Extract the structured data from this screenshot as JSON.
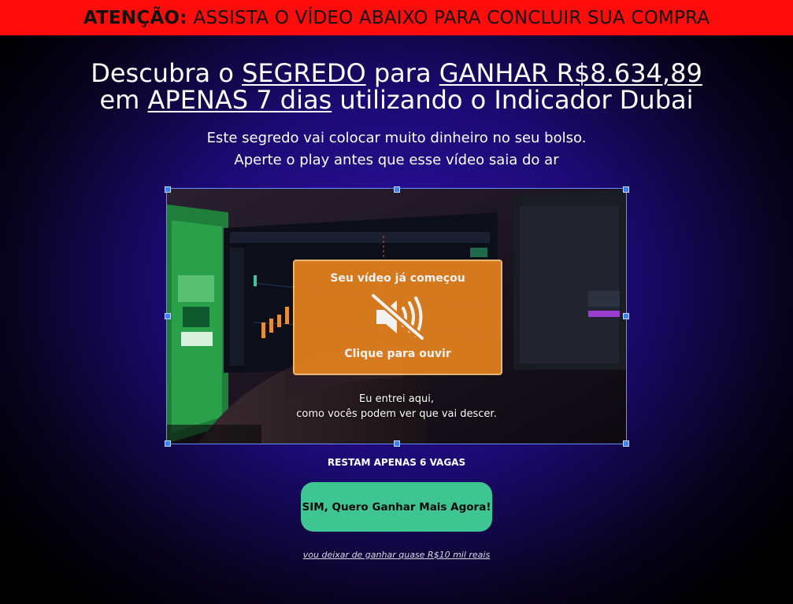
{
  "banner": {
    "strong": "ATENÇÃO:",
    "rest": "ASSISTA O VÍDEO ABAIXO PARA CONCLUIR SUA COMPRA"
  },
  "headline": {
    "w1": "Descubra o",
    "w2": "SEGREDO",
    "w3": "para",
    "w4": "GANHAR R$8.634,89",
    "w5": "em",
    "w6": "APENAS 7 dias",
    "w7": "utilizando o Indicador Dubai"
  },
  "subtext": {
    "line1": "Este segredo vai colocar muito dinheiro no seu bolso.",
    "line2": "Aperte o play antes que esse vídeo saia do ar"
  },
  "video": {
    "overlay_title": "Seu vídeo já começou",
    "overlay_action": "Clique para ouvir",
    "caption_line1": "Eu entrei aqui,",
    "caption_line2": "como vocês podem ver que vai descer.",
    "icon": "muted-speaker-icon"
  },
  "offer": {
    "spots_text": "RESTAM APENAS 6 VAGAS",
    "cta_label": "SIM, Quero Ganhar Mais Agora!",
    "decline_link": "vou deixar de ganhar quase R$10 mil reais"
  },
  "colors": {
    "banner_bg": "#ff0b0b",
    "cta_bg": "#3ec592",
    "overlay_bg": "#e07f1f",
    "page_glow": "#2f12a6"
  }
}
